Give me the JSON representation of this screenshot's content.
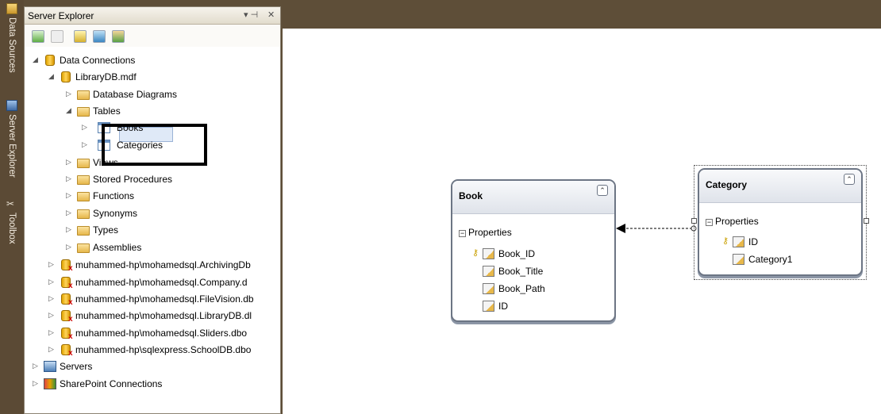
{
  "side_tabs": [
    {
      "label": "Data Sources",
      "icon": "data-sources-icon"
    },
    {
      "label": "Server Explorer",
      "icon": "server-explorer-icon"
    },
    {
      "label": "Toolbox",
      "icon": "toolbox-icon"
    }
  ],
  "panel": {
    "title": "Server Explorer",
    "pin_glyph": "▾ ⊣",
    "close_glyph": "✕"
  },
  "tree": {
    "data_connections": "Data Connections",
    "librarydb": "LibraryDB.mdf",
    "database_diagrams": "Database Diagrams",
    "tables": "Tables",
    "books": "Books",
    "categories": "Categories",
    "views": "Views",
    "stored_procedures": "Stored Procedures",
    "functions": "Functions",
    "synonyms": "Synonyms",
    "types": "Types",
    "assemblies": "Assemblies",
    "connections": [
      "muhammed-hp\\mohamedsql.ArchivingDb",
      "muhammed-hp\\mohamedsql.Company.d",
      "muhammed-hp\\mohamedsql.FileVision.db",
      "muhammed-hp\\mohamedsql.LibraryDB.dl",
      "muhammed-hp\\mohamedsql.Sliders.dbo",
      "muhammed-hp\\sqlexpress.SchoolDB.dbo"
    ],
    "servers": "Servers",
    "sharepoint": "SharePoint Connections"
  },
  "entities": {
    "book": {
      "title": "Book",
      "section": "Properties",
      "properties": [
        "Book_ID",
        "Book_Title",
        "Book_Path",
        "ID"
      ]
    },
    "category": {
      "title": "Category",
      "section": "Properties",
      "properties": [
        "ID",
        "Category1"
      ]
    }
  },
  "glyphs": {
    "collapse": "⌃",
    "section_toggle": "−",
    "expanded": "◢",
    "collapsed": "▷"
  },
  "colors": {
    "chrome": "#5e4e38",
    "selection": "#dfe9f7",
    "highlight_box": "#000000"
  }
}
